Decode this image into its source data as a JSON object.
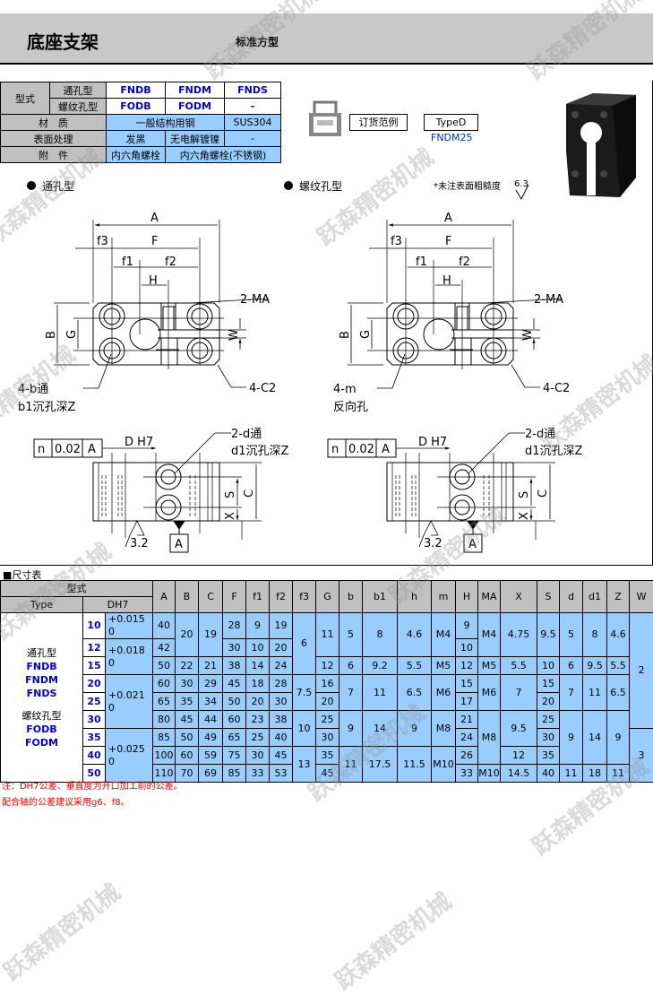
{
  "header": {
    "title": "底座支架",
    "subtitle": "标准方型"
  },
  "spec": {
    "type_label": "型式",
    "through_label": "通孔型",
    "threaded_label": "螺纹孔型",
    "through_models": [
      "FNDB",
      "FNDM",
      "FNDS"
    ],
    "threaded_models": [
      "FODB",
      "FODM",
      "-"
    ],
    "material_label": "材　质",
    "material": [
      "一般结构用钢",
      "SUS304"
    ],
    "surface_label": "表面处理",
    "surface": [
      "发黑",
      "无电解镀镍",
      "-"
    ],
    "accessory_label": "附　件",
    "accessory": [
      "内六角螺栓",
      "内六角螺栓(不锈钢)"
    ]
  },
  "order": {
    "icon": "printer-icon",
    "example_label": "订货范例",
    "type_label": "TypeD",
    "example": "FNDM25"
  },
  "drawings": {
    "through_title": "通孔型",
    "threaded_title": "螺纹孔型",
    "roughness_note": "*未注表面粗糙度",
    "roughness_value": "6.3",
    "A": "A",
    "F": "F",
    "f1": "f1",
    "f2": "f2",
    "f3": "f3",
    "H": "H",
    "B": "B",
    "G": "G",
    "W": "W",
    "S": "S",
    "C": "C",
    "X": "X",
    "ma": "2-MA",
    "c2": "4-C2",
    "b_through": "4-b通",
    "b1_counterbore": "b1沉孔深Z",
    "m": "4-m",
    "reverse": "反向孔",
    "d_through": "2-d通",
    "d1_counterbore": "d1沉孔深Z",
    "dh7": "D H7",
    "tol_n": "n",
    "tol_value": "0.02",
    "datum": "A",
    "roughness_bottom": "3.2"
  },
  "table": {
    "title": "■尺寸表",
    "type_header": "型式",
    "type_sub": "Type",
    "dh7_header": "DH7",
    "columns": [
      "A",
      "B",
      "C",
      "F",
      "f1",
      "f2",
      "f3",
      "G",
      "b",
      "b1",
      "h",
      "m",
      "H",
      "MA",
      "X",
      "S",
      "d",
      "d1",
      "Z",
      "W"
    ],
    "type_groups": [
      {
        "label": "通孔型",
        "models": [
          "FNDB",
          "FNDM",
          "FNDS"
        ]
      },
      {
        "label": "螺纹孔型",
        "models": [
          "FODB",
          "FODM"
        ]
      }
    ],
    "sizes": [
      "10",
      "12",
      "15",
      "20",
      "25",
      "30",
      "35",
      "40",
      "50"
    ],
    "dh7": [
      [
        "+0.015\n0",
        1
      ],
      [
        "+0.018\n0",
        2
      ],
      [
        "+0.021\n0",
        3
      ],
      [
        "+0.025\n0",
        3
      ]
    ],
    "values": {
      "A": [
        [
          "40",
          1
        ],
        [
          "42",
          1
        ],
        [
          "50",
          1
        ],
        [
          "60",
          1
        ],
        [
          "65",
          1
        ],
        [
          "80",
          1
        ],
        [
          "85",
          1
        ],
        [
          "100",
          1
        ],
        [
          "110",
          1
        ]
      ],
      "B": [
        [
          "20",
          2
        ],
        [
          "22",
          1
        ],
        [
          "30",
          1
        ],
        [
          "35",
          1
        ],
        [
          "45",
          1
        ],
        [
          "50",
          1
        ],
        [
          "60",
          1
        ],
        [
          "70",
          1
        ]
      ],
      "C": [
        [
          "19",
          2
        ],
        [
          "21",
          1
        ],
        [
          "29",
          1
        ],
        [
          "34",
          1
        ],
        [
          "44",
          1
        ],
        [
          "49",
          1
        ],
        [
          "59",
          1
        ],
        [
          "69",
          1
        ]
      ],
      "F": [
        [
          "28",
          1
        ],
        [
          "30",
          1
        ],
        [
          "38",
          1
        ],
        [
          "45",
          1
        ],
        [
          "50",
          1
        ],
        [
          "60",
          1
        ],
        [
          "65",
          1
        ],
        [
          "75",
          1
        ],
        [
          "85",
          1
        ]
      ],
      "f1": [
        [
          "9",
          1
        ],
        [
          "10",
          1
        ],
        [
          "14",
          1
        ],
        [
          "18",
          1
        ],
        [
          "20",
          1
        ],
        [
          "23",
          1
        ],
        [
          "25",
          1
        ],
        [
          "30",
          1
        ],
        [
          "33",
          1
        ]
      ],
      "f2": [
        [
          "19",
          1
        ],
        [
          "20",
          1
        ],
        [
          "24",
          1
        ],
        [
          "28",
          1
        ],
        [
          "30",
          1
        ],
        [
          "38",
          1
        ],
        [
          "40",
          1
        ],
        [
          "45",
          1
        ],
        [
          "53",
          1
        ]
      ],
      "f3": [
        [
          "6",
          3
        ],
        [
          "7.5",
          2
        ],
        [
          "10",
          2
        ],
        [
          "13",
          2
        ]
      ],
      "G": [
        [
          "11",
          2
        ],
        [
          "12",
          1
        ],
        [
          "16",
          1
        ],
        [
          "20",
          1
        ],
        [
          "25",
          1
        ],
        [
          "30",
          1
        ],
        [
          "35",
          1
        ],
        [
          "45",
          1
        ]
      ],
      "b": [
        [
          "5",
          2
        ],
        [
          "6",
          1
        ],
        [
          "7",
          2
        ],
        [
          "9",
          2
        ],
        [
          "11",
          2
        ]
      ],
      "b1": [
        [
          "8",
          2
        ],
        [
          "9.2",
          1
        ],
        [
          "11",
          2
        ],
        [
          "14",
          2
        ],
        [
          "17.5",
          2
        ]
      ],
      "h": [
        [
          "4.6",
          2
        ],
        [
          "5.5",
          1
        ],
        [
          "6.5",
          2
        ],
        [
          "9",
          2
        ],
        [
          "11.5",
          2
        ]
      ],
      "m": [
        [
          "M4",
          2
        ],
        [
          "M5",
          1
        ],
        [
          "M6",
          2
        ],
        [
          "M8",
          2
        ],
        [
          "M10",
          2
        ]
      ],
      "H": [
        [
          "9",
          1
        ],
        [
          "10",
          1
        ],
        [
          "12",
          1
        ],
        [
          "15",
          1
        ],
        [
          "17",
          1
        ],
        [
          "21",
          1
        ],
        [
          "24",
          1
        ],
        [
          "26",
          1
        ],
        [
          "33",
          1
        ]
      ],
      "MA": [
        [
          "M4",
          2
        ],
        [
          "M5",
          1
        ],
        [
          "M6",
          2
        ],
        [
          "M8",
          3
        ],
        [
          "M10",
          1
        ]
      ],
      "X": [
        [
          "4.75",
          2
        ],
        [
          "5.5",
          1
        ],
        [
          "7",
          2
        ],
        [
          "9.5",
          2
        ],
        [
          "12",
          1
        ],
        [
          "14.5",
          1
        ]
      ],
      "S": [
        [
          "9.5",
          2
        ],
        [
          "10",
          1
        ],
        [
          "15",
          1
        ],
        [
          "20",
          1
        ],
        [
          "25",
          1
        ],
        [
          "30",
          1
        ],
        [
          "35",
          1
        ],
        [
          "40",
          1
        ]
      ],
      "d": [
        [
          "5",
          2
        ],
        [
          "6",
          1
        ],
        [
          "7",
          2
        ],
        [
          "9",
          3
        ],
        [
          "11",
          1
        ]
      ],
      "d1": [
        [
          "8",
          2
        ],
        [
          "9.5",
          1
        ],
        [
          "11",
          2
        ],
        [
          "14",
          3
        ],
        [
          "18",
          1
        ]
      ],
      "Z": [
        [
          "4.6",
          2
        ],
        [
          "5.5",
          1
        ],
        [
          "6.5",
          2
        ],
        [
          "9",
          3
        ],
        [
          "11",
          1
        ]
      ],
      "W": [
        [
          "2",
          6
        ],
        [
          "3",
          3
        ]
      ]
    }
  },
  "notes": [
    "注：DH7公差、垂直度为开口加工前的公差。",
    "配合轴的公差建议采用g6、f8。"
  ],
  "watermark": "跃森精密机械",
  "colors": {
    "header_gray": "#c8c8c8",
    "cell_blue": "#99ccff",
    "model_blue": "#0000cc",
    "note_red": "#e00000"
  }
}
